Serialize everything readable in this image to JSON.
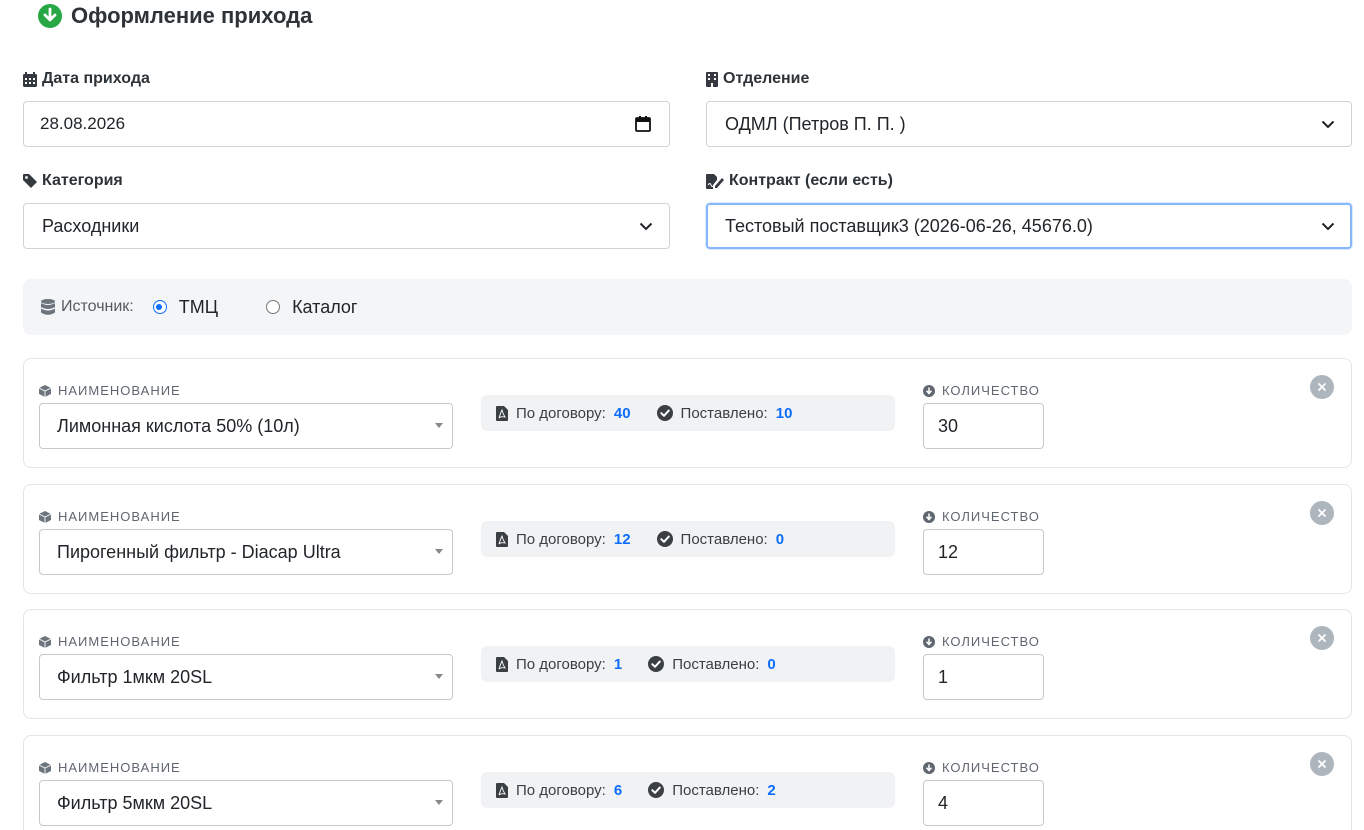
{
  "page": {
    "title": "Оформление прихода"
  },
  "form": {
    "date": {
      "label": "Дата прихода",
      "value": "28.08.2026"
    },
    "department": {
      "label": "Отделение",
      "value": "ОДМЛ (Петров П. П. )"
    },
    "category": {
      "label": "Категория",
      "value": "Расходники"
    },
    "contract": {
      "label": "Контракт (если есть)",
      "value": "Тестовый поставщик3 (2026-06-26, 45676.0)"
    }
  },
  "source": {
    "label": "Источник:",
    "options": [
      {
        "label": "ТМЦ",
        "selected": true
      },
      {
        "label": "Каталог",
        "selected": false
      }
    ]
  },
  "items_labels": {
    "name": "Наименование",
    "quantity": "Количество",
    "contract": "По договору:",
    "delivered": "Поставлено:"
  },
  "items": [
    {
      "name": "Лимонная кислота 50% (10л)",
      "contract": "40",
      "delivered": "10",
      "quantity": "30"
    },
    {
      "name": "Пирогенный фильтр - Diacap Ultra",
      "contract": "12",
      "delivered": "0",
      "quantity": "12"
    },
    {
      "name": "Фильтр 1мкм 20SL",
      "contract": "1",
      "delivered": "0",
      "quantity": "1"
    },
    {
      "name": "Фильтр 5мкм 20SL",
      "contract": "6",
      "delivered": "2",
      "quantity": "4"
    }
  ],
  "colors": {
    "accent": "#0d6efd",
    "success": "#28a745",
    "muted": "#adb5bd"
  }
}
